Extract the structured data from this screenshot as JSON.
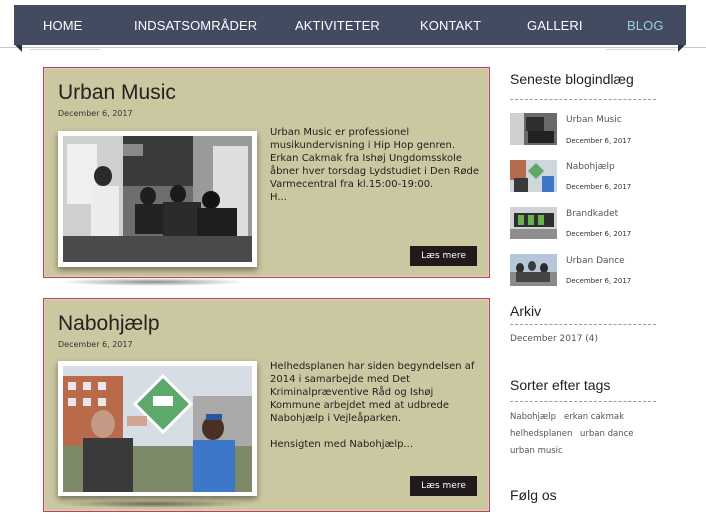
{
  "nav": {
    "items": [
      {
        "label": "HOME",
        "active": false
      },
      {
        "label": "INDSATSOMRÅDER",
        "active": false
      },
      {
        "label": "AKTIVITETER",
        "active": false
      },
      {
        "label": "KONTAKT",
        "active": false
      },
      {
        "label": "GALLERI",
        "active": false
      },
      {
        "label": "BLOG",
        "active": true
      }
    ]
  },
  "posts": [
    {
      "title": "Urban Music",
      "date": "December 6, 2017",
      "excerpt": "Urban Music er professionel musikundervisning i Hip Hop genren. Erkan Cakmak fra Ishøj Ungdomsskole åbner hver torsdag Lydstudiet i Den Røde Varmecentral fra kl.15:00-19:00.",
      "excerpt_tail": "H...",
      "more_label": "Læs mere"
    },
    {
      "title": "Nabohjælp",
      "date": "December 6, 2017",
      "excerpt": "Helhedsplanen har siden begyndelsen af 2014 i samarbejde med Det Kriminalpræventive Råd og Ishøj Kommune arbejdet med at udbrede Nabohjælp i Vejleåparken.",
      "excerpt_tail": "Hensigten med Nabohjælp...",
      "more_label": "Læs mere"
    }
  ],
  "sidebar": {
    "recent_heading": "Seneste blogindlæg",
    "recent": [
      {
        "title": "Urban Music",
        "date": "December 6, 2017"
      },
      {
        "title": "Nabohjælp",
        "date": "December 6, 2017"
      },
      {
        "title": "Brandkadet",
        "date": "December 6, 2017"
      },
      {
        "title": "Urban Dance",
        "date": "December 6, 2017"
      }
    ],
    "archive_heading": "Arkiv",
    "archive_link": "December 2017 (4)",
    "tags_heading": "Sorter efter tags",
    "tags": [
      "Nabohjælp",
      "erkan cakmak",
      "helhedsplanen",
      "urban dance",
      "urban music"
    ],
    "follow_heading": "Følg os"
  }
}
